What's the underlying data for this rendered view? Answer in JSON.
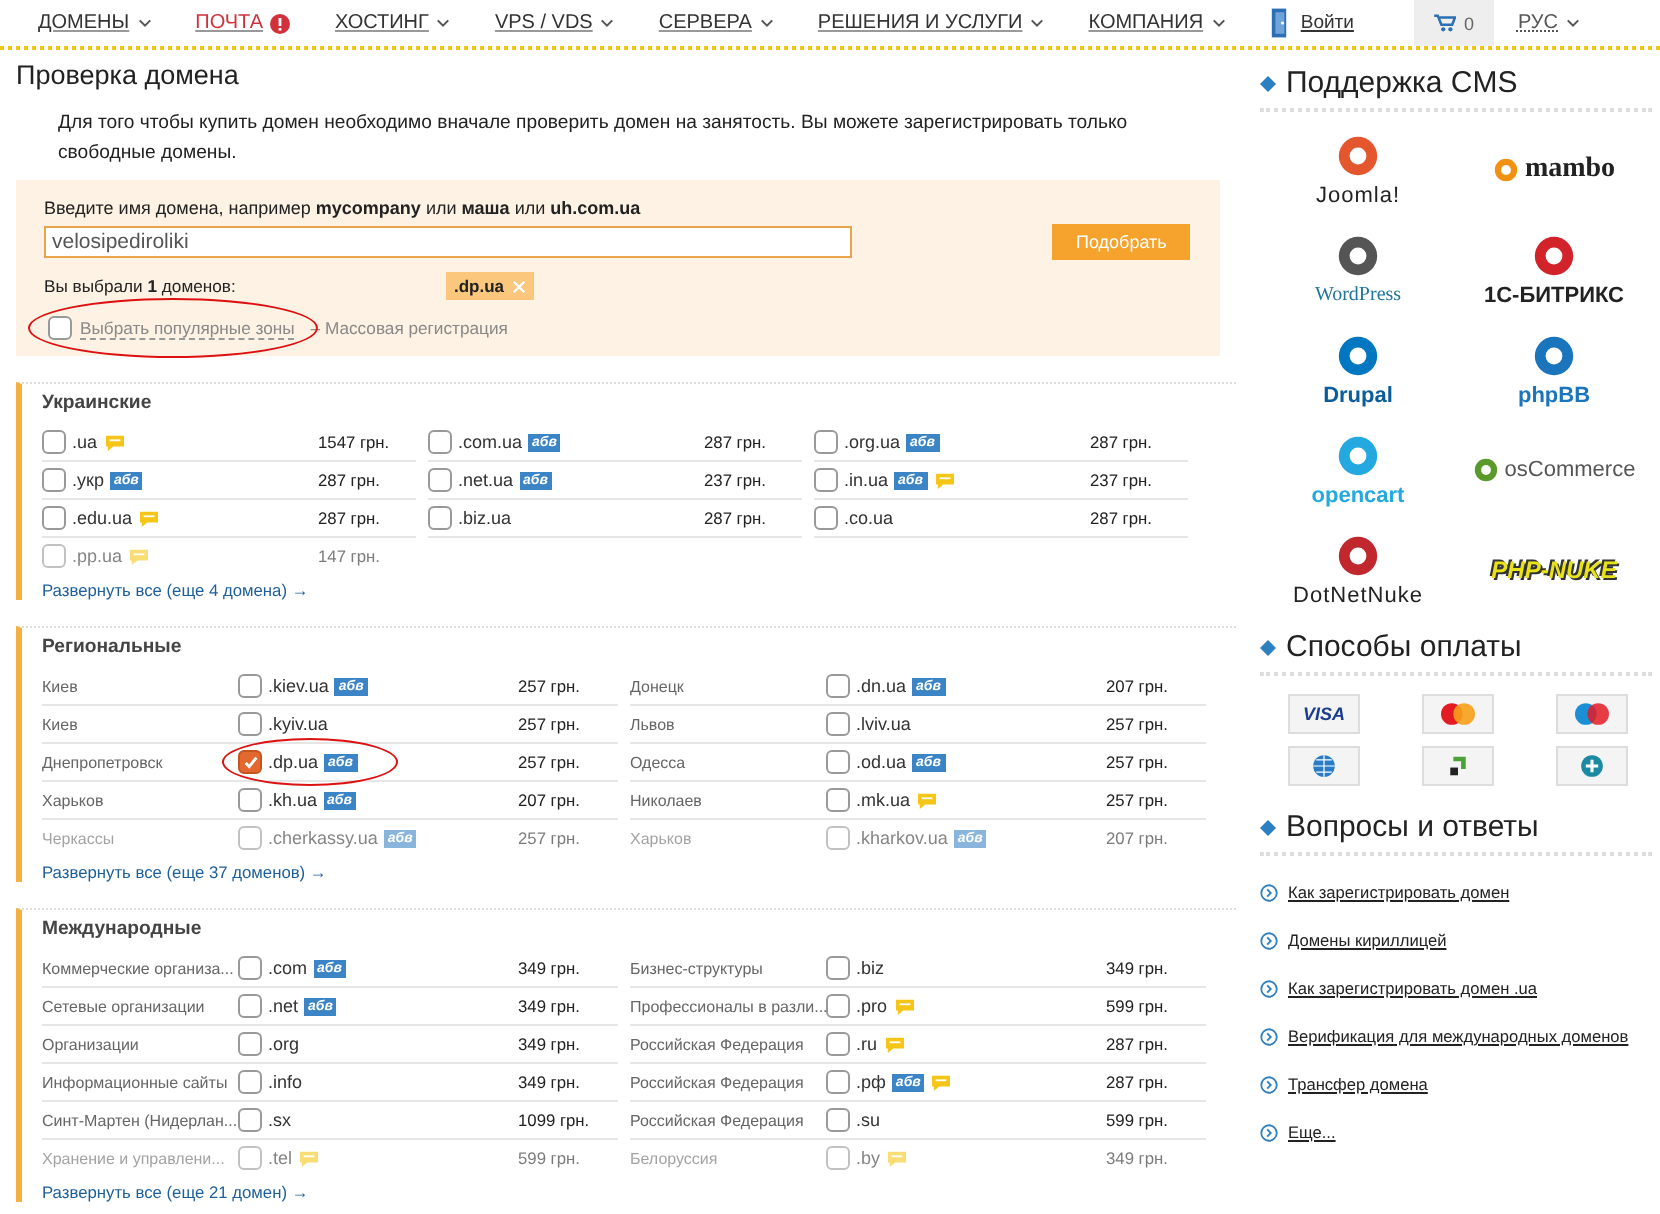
{
  "nav": {
    "items": [
      {
        "label": "ДОМЕНЫ",
        "highlighted": false,
        "alert": false
      },
      {
        "label": "ПОЧТА",
        "highlighted": true,
        "alert": true
      },
      {
        "label": "ХОСТИНГ",
        "highlighted": false,
        "alert": false
      },
      {
        "label": "VPS / VDS",
        "highlighted": false,
        "alert": false
      },
      {
        "label": "СЕРВЕРА",
        "highlighted": false,
        "alert": false
      },
      {
        "label": "РЕШЕНИЯ И УСЛУГИ",
        "highlighted": false,
        "alert": false
      },
      {
        "label": "КОМПАНИЯ",
        "highlighted": false,
        "alert": false
      }
    ],
    "login": "Войти",
    "cart_count": "0",
    "language": "РУС"
  },
  "page_title": "Проверка домена",
  "intro": "Для того чтобы купить домен необходимо вначале проверить домен на занятость. Вы можете зарегистрировать только свободные домены.",
  "search": {
    "label": "Введите имя домена, например **mycompany** или **маша** или **uh.com.ua**",
    "value": "velosipediroliki",
    "button": "Подобрать",
    "selected_text": "Вы выбрали **1** доменов:",
    "selected_tags": [
      ".dp.ua"
    ],
    "popular": {
      "label": "Выбрать популярные зоны",
      "checked": false,
      "circled": true
    },
    "bulk": "– Массовая регистрация"
  },
  "sections": [
    {
      "title": "Украинские",
      "kind": "grid",
      "more": "Развернуть все (еще 4 домена) →",
      "items": [
        {
          "name": ".ua",
          "price": "1547 грн.",
          "checked": false,
          "faded": false,
          "circled": false,
          "badges": [
            {
              "kind": "note"
            }
          ]
        },
        {
          "name": ".com.ua",
          "price": "287 грн.",
          "checked": false,
          "faded": false,
          "circled": false,
          "badges": [
            {
              "kind": "idn",
              "label": "абв"
            }
          ]
        },
        {
          "name": ".org.ua",
          "price": "287 грн.",
          "checked": false,
          "faded": false,
          "circled": false,
          "badges": [
            {
              "kind": "idn",
              "label": "абв"
            }
          ]
        },
        {
          "name": ".укр",
          "price": "287 грн.",
          "checked": false,
          "faded": false,
          "circled": false,
          "badges": [
            {
              "kind": "idn",
              "label": "абв"
            }
          ]
        },
        {
          "name": ".net.ua",
          "price": "237 грн.",
          "checked": false,
          "faded": false,
          "circled": false,
          "badges": [
            {
              "kind": "idn",
              "label": "абв"
            }
          ]
        },
        {
          "name": ".in.ua",
          "price": "237 грн.",
          "checked": false,
          "faded": false,
          "circled": false,
          "badges": [
            {
              "kind": "idn",
              "label": "абв"
            },
            {
              "kind": "note"
            }
          ]
        },
        {
          "name": ".edu.ua",
          "price": "287 грн.",
          "checked": false,
          "faded": false,
          "circled": false,
          "badges": [
            {
              "kind": "note"
            }
          ]
        },
        {
          "name": ".biz.ua",
          "price": "287 грн.",
          "checked": false,
          "faded": false,
          "circled": false
        },
        {
          "name": ".co.ua",
          "price": "287 грн.",
          "checked": false,
          "faded": false,
          "circled": false
        },
        {
          "name": ".pp.ua",
          "price": "147 грн.",
          "checked": false,
          "faded": true,
          "circled": false,
          "badges": [
            {
              "kind": "note"
            }
          ]
        }
      ]
    },
    {
      "title": "Региональные",
      "kind": "described",
      "more": "Развернуть все (еще 37 доменов) →",
      "items": [
        {
          "label": "Киев",
          "name": ".kiev.ua",
          "price": "257 грн.",
          "checked": false,
          "faded": false,
          "circled": false,
          "badges": [
            {
              "kind": "idn",
              "label": "абв"
            }
          ]
        },
        {
          "label": "Донецк",
          "name": ".dn.ua",
          "price": "207 грн.",
          "checked": false,
          "faded": false,
          "circled": false,
          "badges": [
            {
              "kind": "idn",
              "label": "абв"
            }
          ]
        },
        {
          "label": "Киев",
          "name": ".kyiv.ua",
          "price": "257 грн.",
          "checked": false,
          "faded": false,
          "circled": false
        },
        {
          "label": "Львов",
          "name": ".lviv.ua",
          "price": "257 грн.",
          "checked": false,
          "faded": false,
          "circled": false
        },
        {
          "label": "Днепропетровск",
          "name": ".dp.ua",
          "price": "257 грн.",
          "checked": true,
          "faded": false,
          "circled": true,
          "badges": [
            {
              "kind": "idn",
              "label": "абв"
            }
          ]
        },
        {
          "label": "Одесса",
          "name": ".od.ua",
          "price": "257 грн.",
          "checked": false,
          "faded": false,
          "circled": false,
          "badges": [
            {
              "kind": "idn",
              "label": "абв"
            }
          ]
        },
        {
          "label": "Харьков",
          "name": ".kh.ua",
          "price": "207 грн.",
          "checked": false,
          "faded": false,
          "circled": false,
          "badges": [
            {
              "kind": "idn",
              "label": "абв"
            }
          ]
        },
        {
          "label": "Николаев",
          "name": ".mk.ua",
          "price": "257 грн.",
          "checked": false,
          "faded": false,
          "circled": false,
          "badges": [
            {
              "kind": "note"
            }
          ]
        },
        {
          "label": "Черкассы",
          "name": ".cherkassy.ua",
          "price": "257 грн.",
          "checked": false,
          "faded": true,
          "circled": false,
          "badges": [
            {
              "kind": "idn",
              "label": "абв"
            }
          ]
        },
        {
          "label": "Харьков",
          "name": ".kharkov.ua",
          "price": "207 грн.",
          "checked": false,
          "faded": true,
          "circled": false,
          "badges": [
            {
              "kind": "idn",
              "label": "абв"
            }
          ]
        }
      ]
    },
    {
      "title": "Международные",
      "kind": "described",
      "more": "Развернуть все (еще 21 домен) →",
      "items": [
        {
          "label": "Коммерческие организа...",
          "name": ".com",
          "price": "349 грн.",
          "checked": false,
          "faded": false,
          "circled": false,
          "badges": [
            {
              "kind": "idn",
              "label": "абв"
            }
          ]
        },
        {
          "label": "Бизнес-структуры",
          "name": ".biz",
          "price": "349 грн.",
          "checked": false,
          "faded": false,
          "circled": false
        },
        {
          "label": "Сетевые организации",
          "name": ".net",
          "price": "349 грн.",
          "checked": false,
          "faded": false,
          "circled": false,
          "badges": [
            {
              "kind": "idn",
              "label": "абв"
            }
          ]
        },
        {
          "label": "Профессионалы в разли...",
          "name": ".pro",
          "price": "599 грн.",
          "checked": false,
          "faded": false,
          "circled": false,
          "badges": [
            {
              "kind": "note"
            }
          ]
        },
        {
          "label": "Организации",
          "name": ".org",
          "price": "349 грн.",
          "checked": false,
          "faded": false,
          "circled": false
        },
        {
          "label": "Российская Федерация",
          "name": ".ru",
          "price": "287 грн.",
          "checked": false,
          "faded": false,
          "circled": false,
          "badges": [
            {
              "kind": "note"
            }
          ]
        },
        {
          "label": "Информационные сайты",
          "name": ".info",
          "price": "349 грн.",
          "checked": false,
          "faded": false,
          "circled": false
        },
        {
          "label": "Российская Федерация",
          "name": ".рф",
          "price": "287 грн.",
          "checked": false,
          "faded": false,
          "circled": false,
          "badges": [
            {
              "kind": "idn",
              "label": "абв"
            },
            {
              "kind": "note"
            }
          ]
        },
        {
          "label": "Синт-Мартен (Нидерлан...",
          "name": ".sx",
          "price": "1099 грн.",
          "checked": false,
          "faded": false,
          "circled": false
        },
        {
          "label": "Российская Федерация",
          "name": ".su",
          "price": "599 грн.",
          "checked": false,
          "faded": false,
          "circled": false
        },
        {
          "label": "Хранение и управлени...",
          "name": ".tel",
          "price": "599 грн.",
          "checked": false,
          "faded": true,
          "circled": false,
          "badges": [
            {
              "kind": "note"
            }
          ]
        },
        {
          "label": "Белоруссия",
          "name": ".by",
          "price": "349 грн.",
          "checked": false,
          "faded": true,
          "circled": false,
          "badges": [
            {
              "kind": "note"
            }
          ]
        }
      ]
    }
  ],
  "sidebar": {
    "cms_title": "Поддержка CMS",
    "cms": [
      {
        "kind": "joomla",
        "name": "Joomla!"
      },
      {
        "kind": "mambo",
        "name": "mambo"
      },
      {
        "kind": "wordpress",
        "name": "WordPress"
      },
      {
        "kind": "bitrix",
        "name": "1С-БИТРИКС"
      },
      {
        "kind": "drupal",
        "name": "Drupal"
      },
      {
        "kind": "phpbb",
        "name": "phpBB"
      },
      {
        "kind": "opencart",
        "name": "opencart"
      },
      {
        "kind": "oscommerce",
        "name": "osCommerce"
      },
      {
        "kind": "dotnetnuke",
        "name": "DotNetNuke"
      },
      {
        "kind": "phpnuke",
        "name": "PHP-NUKE"
      }
    ],
    "payment_title": "Способы оплаты",
    "payments": [
      {
        "kind": "visa",
        "label": "VISA"
      },
      {
        "kind": "mastercard"
      },
      {
        "kind": "maestro"
      },
      {
        "kind": "webmoney"
      },
      {
        "kind": "privat"
      },
      {
        "kind": "plus"
      }
    ],
    "faq_title": "Вопросы и ответы",
    "faq": [
      "Как зарегистрировать домен",
      "Домены кириллицей",
      "Как зарегистрировать домен .ua",
      "Верификация для международных доменов",
      "Трансфер домена",
      "Еще..."
    ]
  }
}
